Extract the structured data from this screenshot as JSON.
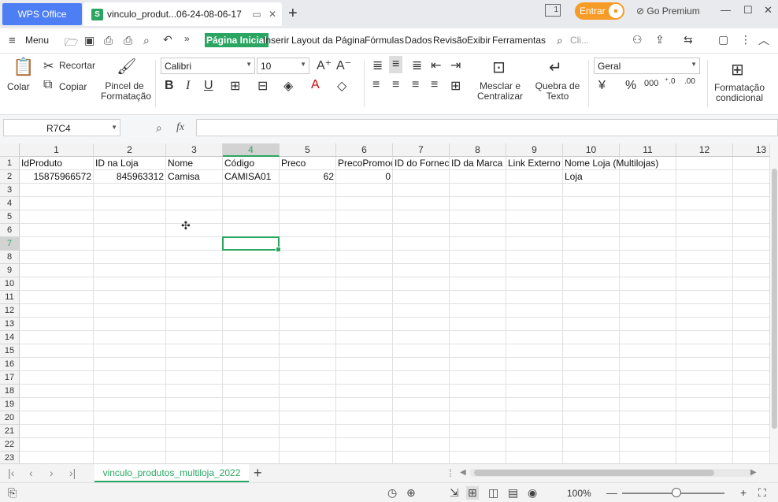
{
  "titlebar": {
    "app_name": "WPS Office",
    "doc_tab_title": "vinculo_produt...06-24-08-06-17",
    "file_badge": "S",
    "login_button": "Entrar",
    "premium": "Go Premium",
    "page_indicator": "1"
  },
  "menu": {
    "menu_label": "Menu",
    "tabs": [
      "Página Inicial",
      "Inserir",
      "Layout da Página",
      "Fórmulas",
      "Dados",
      "Revisão",
      "Exibir",
      "Ferramentas"
    ],
    "search_placeholder": "Cli..."
  },
  "ribbon": {
    "paste": "Colar",
    "cut": "Recortar",
    "copy": "Copiar",
    "format_painter_1": "Pincel de",
    "format_painter_2": "Formatação",
    "font_name": "Calibri",
    "font_size": "10",
    "bold": "B",
    "italic": "I",
    "underline": "U",
    "merge_1": "Mesclar e",
    "merge_2": "Centralizar",
    "wrap_1": "Quebra de",
    "wrap_2": "Texto",
    "number_format": "Geral",
    "currency": "¥",
    "percent": "%",
    "thousands": "000",
    "cond_1": "Formatação",
    "cond_2": "condicional"
  },
  "formula_bar": {
    "name_box": "R7C4",
    "fx": "fx",
    "formula": ""
  },
  "grid": {
    "columns": [
      "1",
      "2",
      "3",
      "4",
      "5",
      "6",
      "7",
      "8",
      "9",
      "10",
      "11",
      "12",
      "13"
    ],
    "rows": [
      "1",
      "2",
      "3",
      "4",
      "5",
      "6",
      "7",
      "8",
      "9",
      "10",
      "11",
      "12",
      "13",
      "14",
      "15",
      "16",
      "17",
      "18",
      "19",
      "20",
      "21",
      "22",
      "23"
    ],
    "selected_cell": "R7C4",
    "header_row": [
      "IdProduto",
      "ID na Loja",
      "Nome",
      "Código",
      "Preco",
      "PrecoPromocional",
      "ID do Fornecedor",
      "ID da Marca",
      "Link Externo",
      "Nome Loja (Multilojas)",
      "",
      "",
      ""
    ],
    "data_row": [
      "15875966572",
      "845963312",
      "Camisa",
      "CAMISA01",
      "62",
      "0",
      "",
      "",
      "",
      "Loja",
      "",
      "",
      ""
    ]
  },
  "sheets": {
    "active": "vinculo_produtos_multiloja_2022"
  },
  "status": {
    "zoom": "100%"
  }
}
